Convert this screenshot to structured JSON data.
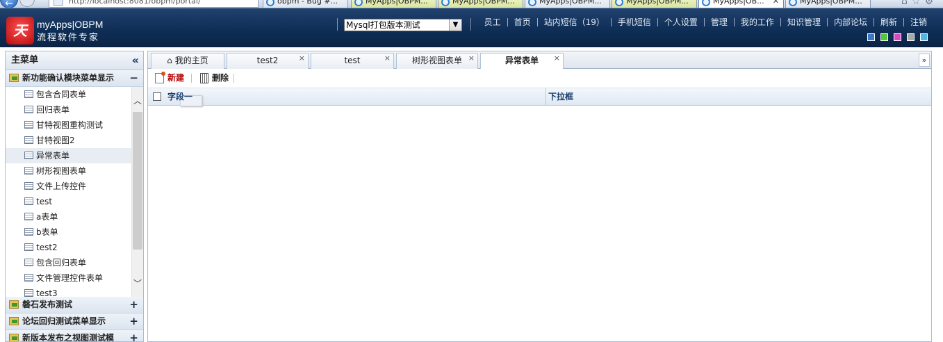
{
  "browser": {
    "address": "http://localhost:8081/obpm/portal/",
    "tabs": [
      {
        "label": "obpm - Bug #...",
        "state": "normal"
      },
      {
        "label": "MyApps|OBPM...",
        "state": "highlight"
      },
      {
        "label": "MyApps|OBPM...",
        "state": "highlight"
      },
      {
        "label": "MyApps|OBPM...",
        "state": "normal"
      },
      {
        "label": "MyApps|OBPM...",
        "state": "highlight"
      },
      {
        "label": "MyApps|OB...",
        "state": "active"
      },
      {
        "label": "MyApps|OBPM...",
        "state": "normal"
      }
    ]
  },
  "header": {
    "brand_line1": "myApps|OBPM",
    "brand_line2": "流程软件专家",
    "domain_select": "Mysql打包版本测试",
    "nav": [
      "员工",
      "首页",
      "站内短信（19）",
      "手机短信",
      "个人设置",
      "管理",
      "我的工作",
      "知识管理",
      "内部论坛",
      "刷新",
      "注销"
    ],
    "skin_colors": [
      "#3a78c8",
      "#55c63a",
      "#d64bc0",
      "#a9a9a9",
      "#4fb8e6"
    ]
  },
  "sidebar": {
    "title": "主菜单",
    "collapse_icon": "«",
    "sections": [
      {
        "title": "新功能确认模块菜单显示",
        "toggle": "−",
        "items": [
          "包含合同表单",
          "回归表单",
          "甘特视图重构测试",
          "甘特视图2",
          "异常表单",
          "树形视图表单",
          "文件上传控件",
          "test",
          "a表单",
          "b表单",
          "test2",
          "包含回归表单",
          "文件管理控件表单",
          "test3"
        ],
        "active_index": 4
      },
      {
        "title": "磐石发布测试",
        "toggle": "+"
      },
      {
        "title": "论坛回归测试菜单显示",
        "toggle": "+"
      },
      {
        "title": "新版本发布之视图测试模",
        "toggle": "+"
      }
    ]
  },
  "main": {
    "tabs": [
      "我的主页",
      "test2",
      "test",
      "树形视图表单",
      "异常表单"
    ],
    "active_tab": 4,
    "toolbar": {
      "new_label": "新建",
      "delete_label": "删除"
    },
    "grid": {
      "columns": [
        "字段一",
        "下拉框"
      ]
    }
  }
}
